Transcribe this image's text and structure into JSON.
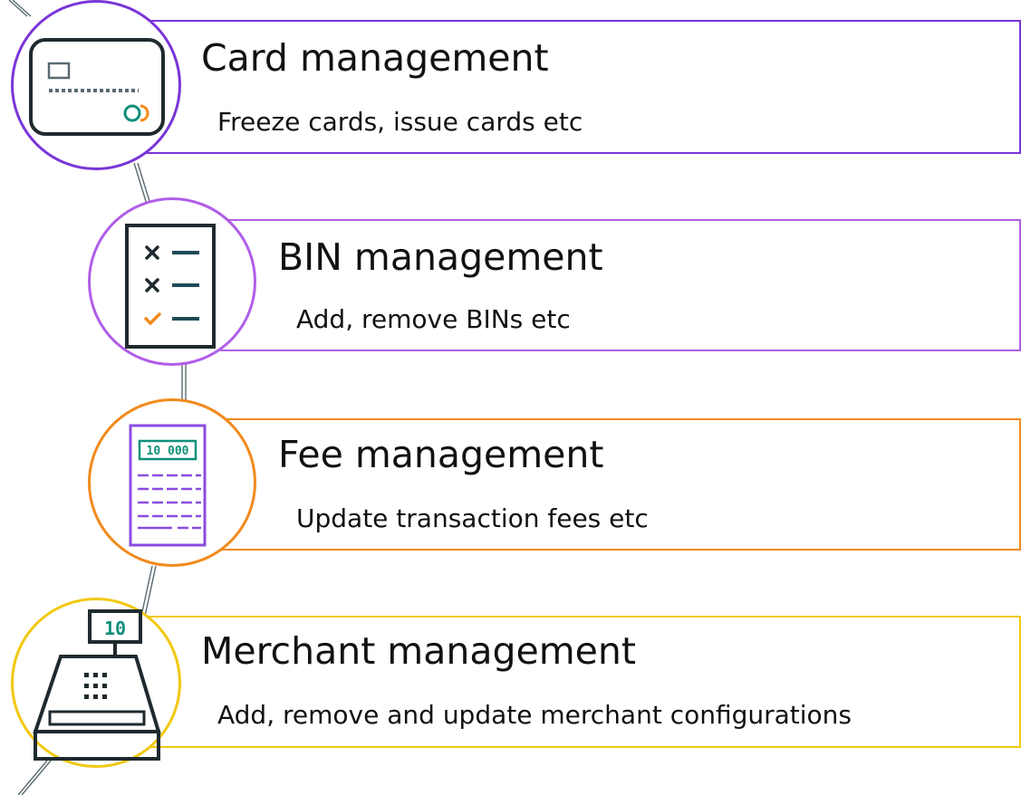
{
  "colors": {
    "card": "#7a35d8",
    "bin": "#b05ee8",
    "fee": "#f28a1c",
    "merchant": "#f2c80f",
    "connector": "#5a6a72",
    "icon_dark": "#1f2a2f",
    "icon_teal": "#0e8f7a",
    "icon_orange": "#f28a1c",
    "icon_purple": "#8a4de0"
  },
  "items": [
    {
      "title": "Card management",
      "description": "Freeze cards, issue cards etc",
      "icon": "credit-card-icon"
    },
    {
      "title": "BIN management",
      "description": "Add, remove BINs etc",
      "icon": "checklist-icon"
    },
    {
      "title": "Fee management",
      "description": "Update transaction fees etc",
      "icon": "calculator-icon"
    },
    {
      "title": "Merchant management",
      "description": "Add, remove and update merchant configurations",
      "icon": "cash-register-icon"
    }
  ],
  "icon_text": {
    "calculator_display": "10 000",
    "register_display": "10"
  }
}
